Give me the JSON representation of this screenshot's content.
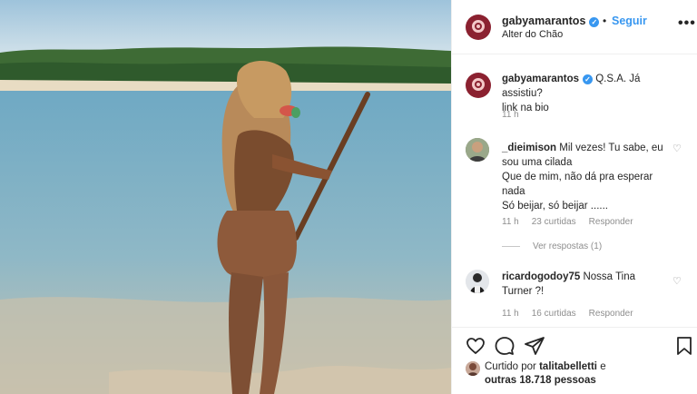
{
  "post": {
    "username": "gabyamarantos",
    "verified_mark": "✓",
    "separator": "•",
    "follow_label": "Seguir",
    "location": "Alter do Chão",
    "more_label": "•••"
  },
  "comments": [
    {
      "username": "gabyamarantos",
      "verified_mark": "✓",
      "text_lines": [
        "Q.S.A. Já assistiu?",
        "link na bio"
      ],
      "time": "11 h"
    },
    {
      "username": "_dieimison",
      "text_lines": [
        "Mil vezes! Tu sabe, eu",
        "sou uma cilada",
        "Que de mim, não dá pra esperar",
        "nada",
        "Só beijar, só beijar ......"
      ],
      "time": "11 h",
      "likes": "23 curtidas",
      "reply_label": "Responder",
      "view_replies": "Ver respostas (1)"
    },
    {
      "username": "ricardogodoy75",
      "text_lines": [
        "Nossa Tina",
        "Turner ?!"
      ],
      "time": "11 h",
      "likes": "16 curtidas",
      "reply_label": "Responder"
    }
  ],
  "actions": {
    "like_icon": "heart-icon",
    "comment_icon": "comment-icon",
    "share_icon": "share-icon",
    "save_icon": "bookmark-icon",
    "liked_prefix": "Curtido por",
    "liked_user": "talitabelletti",
    "liked_and": "e",
    "liked_others": "outras 18.718 pessoas"
  },
  "colors": {
    "accent": "#3897f0",
    "muted": "#8e8e8e",
    "text": "#262626",
    "avatar_bg": "#8b2130"
  }
}
